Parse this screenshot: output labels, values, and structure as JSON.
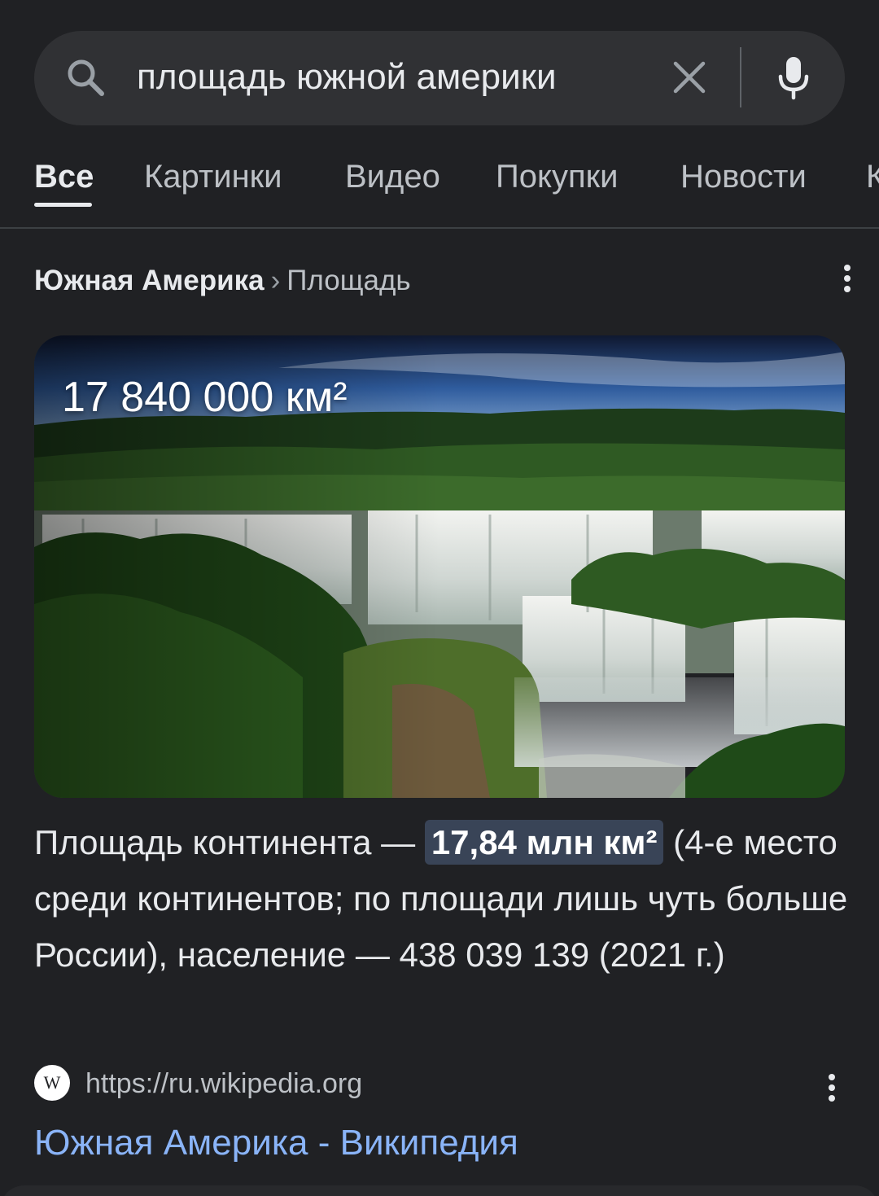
{
  "search": {
    "query": "площадь южной америки"
  },
  "tabs": [
    {
      "label": "Все"
    },
    {
      "label": "Картинки"
    },
    {
      "label": "Видео"
    },
    {
      "label": "Покупки"
    },
    {
      "label": "Новости"
    },
    {
      "label": "К"
    }
  ],
  "result": {
    "breadcrumb_entity": "Южная Америка",
    "breadcrumb_separator": "›",
    "breadcrumb_attribute": "Площадь",
    "image_value": "17 840 000 км²",
    "snippet_before": "Площадь континента — ",
    "snippet_highlight": "17,84 млн км²",
    "snippet_after": " (4-е место среди континентов; по площади лишь чуть больше России), население — 438 039 139 (2021 г.)",
    "favicon_letter": "W",
    "source_url": "https://ru.wikipedia.org",
    "title": "Южная Америка - Википедия"
  },
  "colors": {
    "background": "#202124",
    "search_bar": "#303134",
    "link": "#8ab4f8",
    "highlight": "#394457"
  }
}
